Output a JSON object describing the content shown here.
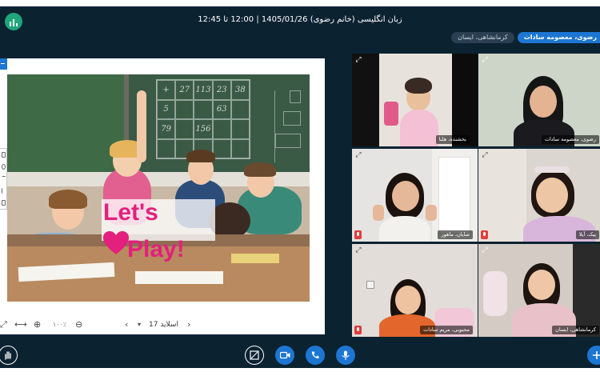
{
  "header": {
    "title": "زبان انگلیسی (خانم رضوی) 1405/01/26 | 12:00 تا 12:45",
    "user_chips": [
      "رضوی، معصومه سادات",
      "کرمانشاهی، ایسان"
    ]
  },
  "slide": {
    "board_numbers": [
      "+",
      "27",
      "113",
      "23",
      "38",
      "5",
      "",
      "",
      "63",
      "",
      "79",
      "",
      "156",
      "",
      "",
      "",
      "",
      "",
      "",
      ""
    ],
    "overlay_line1": "Let's",
    "overlay_line2": "Play!"
  },
  "presentation_toolbar": {
    "slide_label": "اسلاید 17",
    "zoom_label": "۱۰۰٪"
  },
  "video_tiles": [
    {
      "name": "بخشنده، هلنا",
      "mic_muted": false
    },
    {
      "name": "رضوی، معصومه سادات",
      "mic_muted": false,
      "active": true
    },
    {
      "name": "شایان، ماهور",
      "mic_muted": true
    },
    {
      "name": "پیک، آیلا",
      "mic_muted": true
    },
    {
      "name": "محبوبی، مریم سادات",
      "mic_muted": true
    },
    {
      "name": "کرمانشاهی، ایسان",
      "mic_muted": false
    }
  ],
  "colors": {
    "background": "#0b2231",
    "accent": "#1d76d2",
    "slide_text": "#e3207d",
    "muted": "#e23c3c"
  },
  "icons": {
    "logo": "bigbluebutton-logo-icon",
    "raise_hand": "hand-icon",
    "screen_share": "screen-share-icon",
    "camera": "camera-icon",
    "phone": "phone-icon",
    "microphone": "microphone-icon",
    "plus": "plus-icon"
  }
}
